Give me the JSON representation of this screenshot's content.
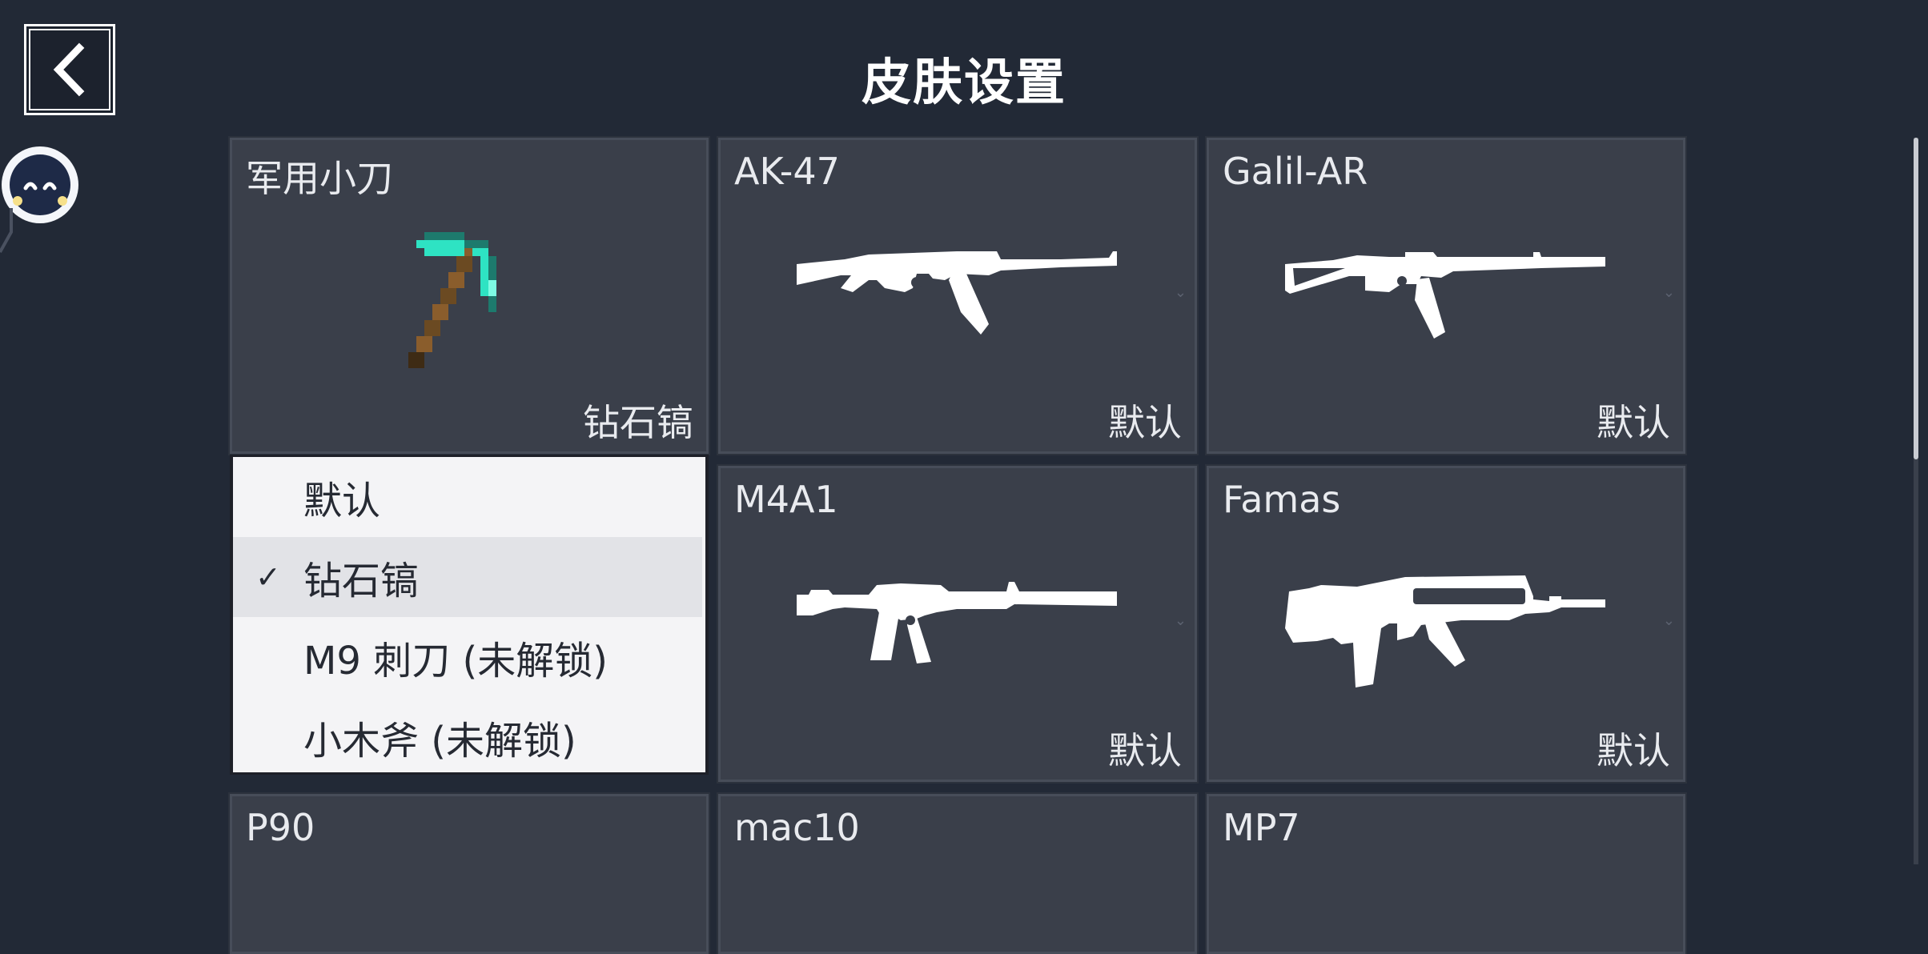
{
  "header": {
    "title": "皮肤设置",
    "back_icon": "chevron-left-icon"
  },
  "weapons": [
    {
      "name": "军用小刀",
      "skin": "钻石镐",
      "icon": "diamond-pickaxe-icon"
    },
    {
      "name": "AK-47",
      "skin": "默认",
      "icon": "ak47-silhouette-icon"
    },
    {
      "name": "Galil-AR",
      "skin": "默认",
      "icon": "galil-silhouette-icon"
    },
    {
      "name": "",
      "skin": "",
      "icon": ""
    },
    {
      "name": "M4A1",
      "skin": "默认",
      "icon": "m4a1-silhouette-icon"
    },
    {
      "name": "Famas",
      "skin": "默认",
      "icon": "famas-silhouette-icon"
    },
    {
      "name": "P90",
      "skin": "",
      "icon": ""
    },
    {
      "name": "mac10",
      "skin": "",
      "icon": ""
    },
    {
      "name": "MP7",
      "skin": "",
      "icon": ""
    }
  ],
  "skin_dropdown": {
    "options": [
      {
        "label": "默认",
        "selected": false
      },
      {
        "label": "钻石镐",
        "selected": true
      },
      {
        "label": "M9 刺刀 (未解锁)",
        "selected": false
      },
      {
        "label": "小木斧 (未解锁)",
        "selected": false
      }
    ],
    "check_mark": "✓"
  },
  "colors": {
    "background": "#222936",
    "card": "#3a3f4a",
    "dropdown": "#f4f4f6"
  }
}
